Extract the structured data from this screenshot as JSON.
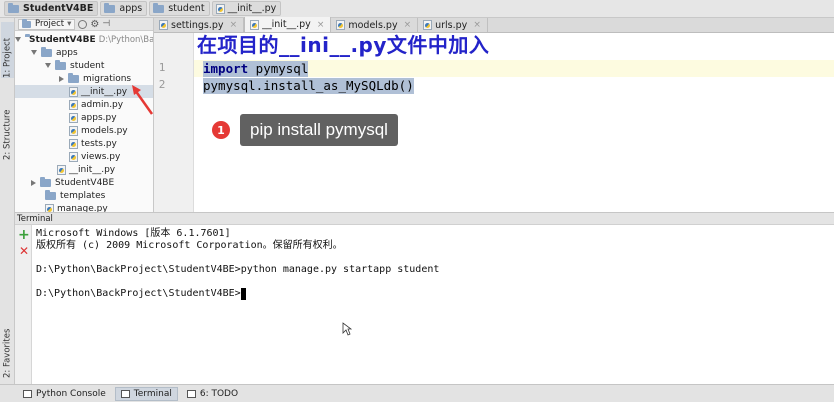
{
  "breadcrumb": [
    "StudentV4BE",
    "apps",
    "student",
    "__init__.py"
  ],
  "left_strip": {
    "project_tab": "1: Project",
    "structure_tab": "2: Structure",
    "favorites_tab": "2: Favorites"
  },
  "project_panel": {
    "selector": "Project",
    "tree": [
      {
        "label": "StudentV4BE",
        "extra": "D:\\Python\\Ba",
        "kind": "folder",
        "state": "down"
      },
      {
        "label": "apps",
        "kind": "folder",
        "state": "down"
      },
      {
        "label": "student",
        "kind": "folder",
        "state": "down"
      },
      {
        "label": "migrations",
        "kind": "folder",
        "state": "right"
      },
      {
        "label": "__init__.py",
        "kind": "file",
        "selected": true
      },
      {
        "label": "admin.py",
        "kind": "file"
      },
      {
        "label": "apps.py",
        "kind": "file"
      },
      {
        "label": "models.py",
        "kind": "file"
      },
      {
        "label": "tests.py",
        "kind": "file"
      },
      {
        "label": "views.py",
        "kind": "file"
      },
      {
        "label": "__init__.py",
        "kind": "file"
      },
      {
        "label": "StudentV4BE",
        "kind": "folder",
        "state": "right"
      },
      {
        "label": "templates",
        "kind": "folder"
      },
      {
        "label": "manage.py",
        "kind": "file"
      }
    ]
  },
  "tabs": [
    {
      "label": "settings.py",
      "active": false
    },
    {
      "label": "__init__.py",
      "active": true
    },
    {
      "label": "models.py",
      "active": false
    },
    {
      "label": "urls.py",
      "active": false
    }
  ],
  "editor": {
    "annotation": "在项目的__ini__.py文件中加入",
    "line_numbers": [
      "1",
      "2"
    ],
    "lines": [
      {
        "keyword": "import",
        "rest": " pymysql"
      },
      {
        "keyword": "",
        "rest": "pymysql.install_as_MySQLdb()"
      }
    ],
    "step_number": "1",
    "tooltip": "pip install pymysql"
  },
  "terminal": {
    "title": "Terminal",
    "lines": [
      "Microsoft Windows [版本 6.1.7601]",
      "版权所有 (c) 2009 Microsoft Corporation。保留所有权利。",
      "",
      "D:\\Python\\BackProject\\StudentV4BE>python manage.py startapp student",
      "",
      "D:\\Python\\BackProject\\StudentV4BE>"
    ]
  },
  "bottom_bar": [
    {
      "label": "Python Console",
      "active": false
    },
    {
      "label": "Terminal",
      "active": true
    },
    {
      "label": "6: TODO",
      "active": false
    }
  ],
  "colors": {
    "annotation": "#2323c9",
    "selection": "#b0c0d6",
    "badge": "#e53935",
    "keyword": "#000080"
  }
}
